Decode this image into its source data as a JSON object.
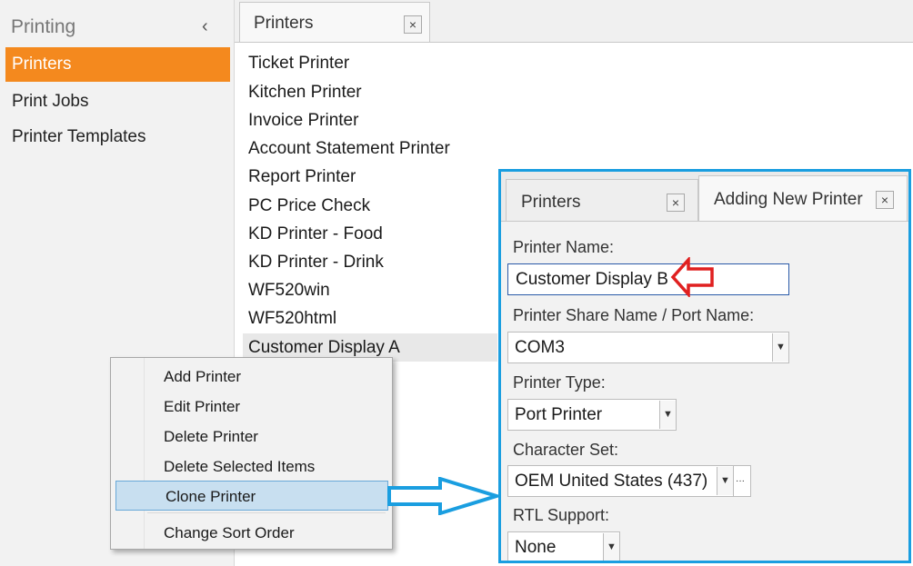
{
  "left_panel": {
    "title": "Printing",
    "collapse_glyph": "‹",
    "items": [
      {
        "label": "Printers",
        "active": true
      },
      {
        "label": "Print Jobs",
        "active": false
      },
      {
        "label": "Printer Templates",
        "active": false
      }
    ]
  },
  "main": {
    "tab_label": "Printers",
    "close_glyph": "×",
    "printers": [
      "Ticket Printer",
      "Kitchen Printer",
      "Invoice Printer",
      "Account Statement Printer",
      "Report Printer",
      "PC Price Check",
      "KD Printer - Food",
      "KD Printer - Drink",
      "WF520win",
      "WF520html",
      "Customer Display A"
    ],
    "selected_index": 10
  },
  "context_menu": {
    "items": [
      "Add Printer",
      "Edit Printer",
      "Delete Printer",
      "Delete Selected Items",
      "Clone Printer",
      "Change Sort Order"
    ],
    "highlighted": "Clone Printer"
  },
  "callout": {
    "tabs": [
      {
        "label": "Printers",
        "active": false
      },
      {
        "label": "Adding New Printer",
        "active": true
      }
    ],
    "form": {
      "printer_name_label": "Printer Name:",
      "printer_name_value": "Customer Display B",
      "share_name_label": "Printer Share Name / Port Name:",
      "share_name_value": "COM3",
      "printer_type_label": "Printer Type:",
      "printer_type_value": "Port Printer",
      "charset_label": "Character Set:",
      "charset_value": "OEM United States (437)",
      "charset_more_glyph": "···",
      "rtl_label": "RTL Support:",
      "rtl_value": "None"
    },
    "dropdown_glyph": "▼"
  },
  "colors": {
    "accent_orange": "#f4891e",
    "callout_border": "#1a9ee0",
    "highlight_fill": "#c8dff0",
    "red_arrow": "#e02020"
  }
}
